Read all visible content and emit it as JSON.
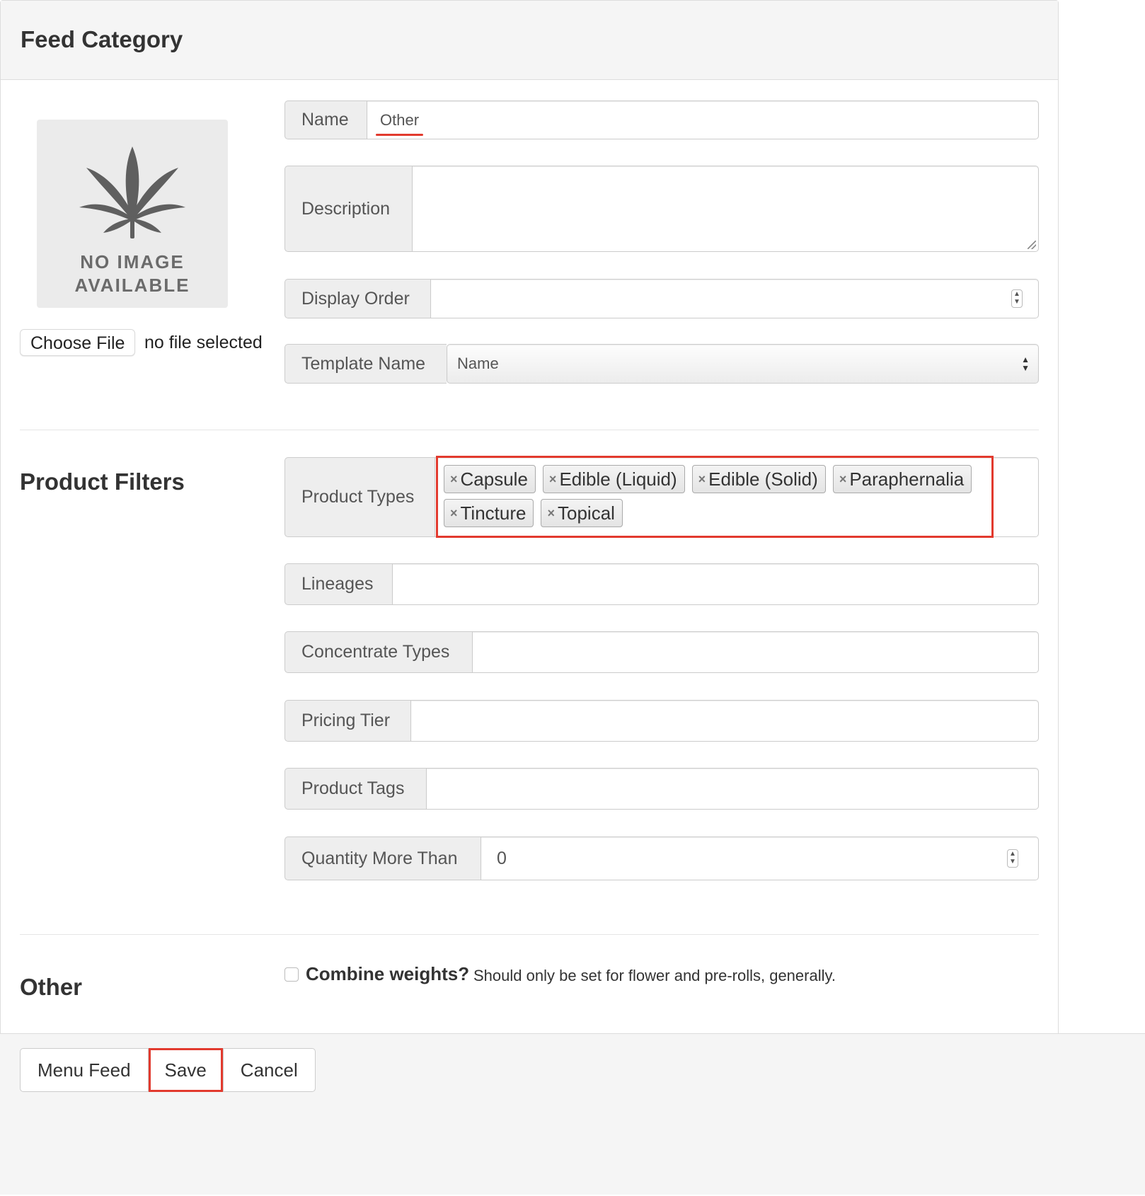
{
  "header": {
    "title": "Feed Category"
  },
  "image": {
    "placeholder_line1": "NO IMAGE",
    "placeholder_line2": "AVAILABLE",
    "icon": "cannabis-leaf-icon",
    "choose_file_label": "Choose File",
    "file_status": "no file selected"
  },
  "fields": {
    "name": {
      "label": "Name",
      "value": "Other"
    },
    "description": {
      "label": "Description",
      "value": ""
    },
    "display_order": {
      "label": "Display Order",
      "value": ""
    },
    "template_name": {
      "label": "Template Name",
      "selected": "Name"
    }
  },
  "product_filters": {
    "title": "Product Filters",
    "product_types": {
      "label": "Product Types",
      "tags": [
        "Capsule",
        "Edible (Liquid)",
        "Edible (Solid)",
        "Paraphernalia",
        "Tincture",
        "Topical"
      ]
    },
    "lineages": {
      "label": "Lineages"
    },
    "concentrate_types": {
      "label": "Concentrate Types"
    },
    "pricing_tier": {
      "label": "Pricing Tier"
    },
    "product_tags": {
      "label": "Product Tags"
    },
    "quantity_more_than": {
      "label": "Quantity More Than",
      "value": "0"
    }
  },
  "other": {
    "title": "Other",
    "combine_label": "Combine weights?",
    "combine_help": "Should only be set for flower and pre-rolls, generally.",
    "combine_checked": false
  },
  "footer": {
    "menu_feed_label": "Menu Feed",
    "save_label": "Save",
    "cancel_label": "Cancel"
  },
  "colors": {
    "highlight": "#e23a2e",
    "addon_bg": "#eeeeee",
    "heading_bg": "#f5f5f5"
  }
}
